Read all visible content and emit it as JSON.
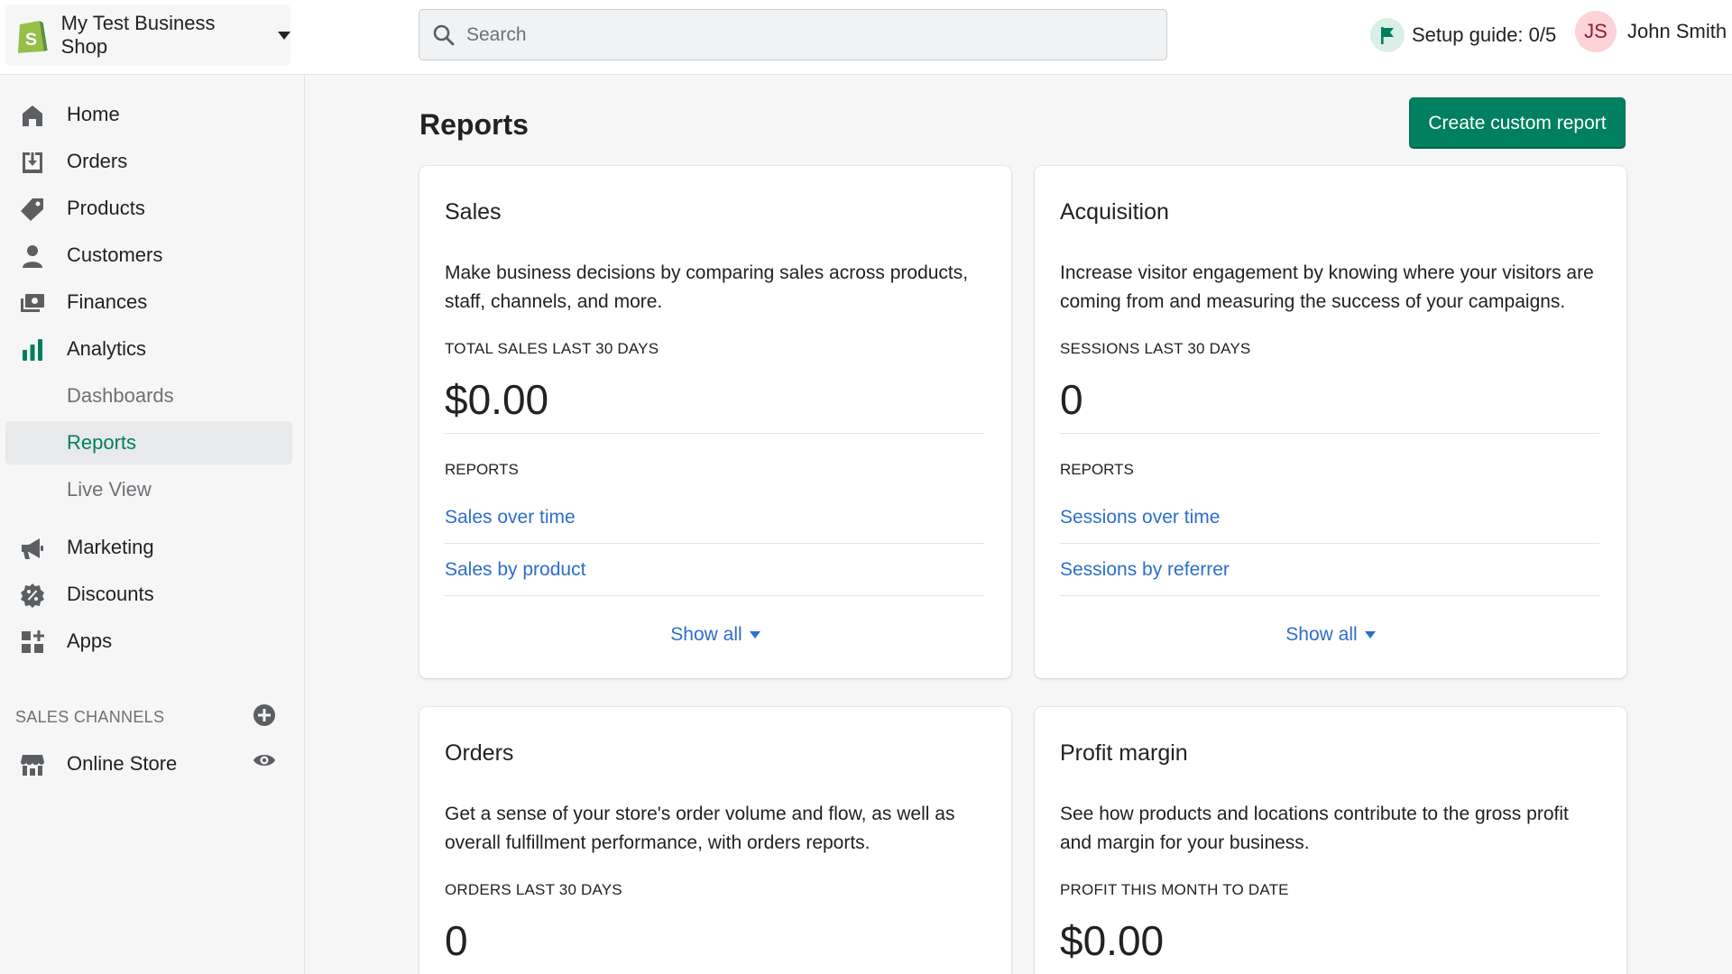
{
  "topbar": {
    "store_name": "My Test Business Shop",
    "search_placeholder": "Search",
    "setup_guide": "Setup guide: 0/5",
    "user_initials": "JS",
    "user_name": "John Smith"
  },
  "sidebar": {
    "items": [
      {
        "label": "Home",
        "icon": "home-icon"
      },
      {
        "label": "Orders",
        "icon": "orders-icon"
      },
      {
        "label": "Products",
        "icon": "tag-icon"
      },
      {
        "label": "Customers",
        "icon": "person-icon"
      },
      {
        "label": "Finances",
        "icon": "finances-icon"
      },
      {
        "label": "Analytics",
        "icon": "bar-chart-icon"
      },
      {
        "label": "Dashboards"
      },
      {
        "label": "Reports",
        "active": true
      },
      {
        "label": "Live View"
      },
      {
        "label": "Marketing",
        "icon": "megaphone-icon"
      },
      {
        "label": "Discounts",
        "icon": "discount-icon"
      },
      {
        "label": "Apps",
        "icon": "apps-icon"
      }
    ],
    "sales_channels_label": "SALES CHANNELS",
    "online_store": "Online Store"
  },
  "main": {
    "title": "Reports",
    "create_button": "Create custom report",
    "cards": [
      {
        "title": "Sales",
        "description": "Make business decisions by comparing sales across products, staff, channels, and more.",
        "metric_label": "TOTAL SALES LAST 30 DAYS",
        "metric_value": "$0.00",
        "reports_label": "REPORTS",
        "links": [
          "Sales over time",
          "Sales by product"
        ],
        "show_all": "Show all"
      },
      {
        "title": "Acquisition",
        "description": "Increase visitor engagement by knowing where your visitors are coming from and measuring the success of your campaigns.",
        "metric_label": "SESSIONS LAST 30 DAYS",
        "metric_value": "0",
        "reports_label": "REPORTS",
        "links": [
          "Sessions over time",
          "Sessions by referrer"
        ],
        "show_all": "Show all"
      },
      {
        "title": "Orders",
        "description": "Get a sense of your store's order volume and flow, as well as overall fulfillment performance, with orders reports.",
        "metric_label": "ORDERS LAST 30 DAYS",
        "metric_value": "0"
      },
      {
        "title": "Profit margin",
        "description": "See how products and locations contribute to the gross profit and margin for your business.",
        "metric_label": "PROFIT THIS MONTH TO DATE",
        "metric_value": "$0.00"
      }
    ]
  },
  "colors": {
    "accent_green": "#008060",
    "link_blue": "#2c6ecb",
    "active_nav_green": "#007f5f"
  }
}
